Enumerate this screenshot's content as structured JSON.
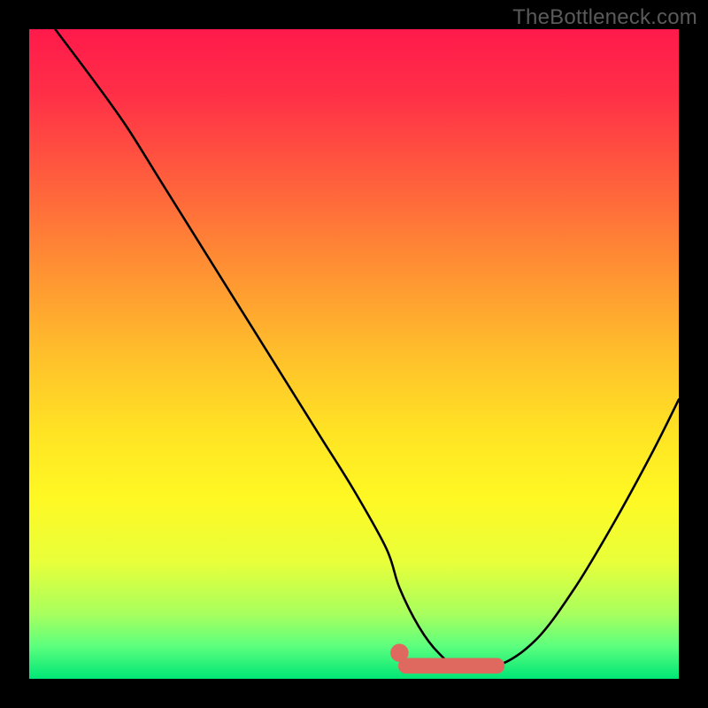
{
  "watermark": "TheBottleneck.com",
  "colors": {
    "frame": "#000000",
    "gradient_stops": [
      {
        "offset": 0.0,
        "color": "#ff1a4b"
      },
      {
        "offset": 0.1,
        "color": "#ff2f47"
      },
      {
        "offset": 0.22,
        "color": "#ff5a3e"
      },
      {
        "offset": 0.35,
        "color": "#ff8a34"
      },
      {
        "offset": 0.5,
        "color": "#ffbf2b"
      },
      {
        "offset": 0.62,
        "color": "#ffe324"
      },
      {
        "offset": 0.72,
        "color": "#fff823"
      },
      {
        "offset": 0.82,
        "color": "#e8ff3a"
      },
      {
        "offset": 0.9,
        "color": "#a8ff5e"
      },
      {
        "offset": 0.95,
        "color": "#5cff7e"
      },
      {
        "offset": 1.0,
        "color": "#00e676"
      }
    ],
    "marker": "#e0695f",
    "curve": "#000000"
  },
  "chart_data": {
    "type": "line",
    "title": "",
    "xlabel": "",
    "ylabel": "",
    "xlim": [
      0,
      100
    ],
    "ylim": [
      0,
      100
    ],
    "grid": false,
    "series": [
      {
        "name": "bottleneck-curve",
        "x": [
          4,
          10,
          15,
          20,
          25,
          30,
          35,
          40,
          45,
          50,
          55,
          57,
          60,
          63,
          66,
          72,
          78,
          84,
          90,
          96,
          100
        ],
        "values": [
          100,
          92,
          85,
          77,
          69,
          61,
          53,
          45,
          37,
          29,
          20,
          14,
          8,
          4,
          2,
          2,
          6,
          14,
          24,
          35,
          43
        ]
      }
    ],
    "markers": [
      {
        "name": "marker-dot",
        "shape": "circle",
        "x": 57,
        "y": 4,
        "r": 1.4
      },
      {
        "name": "marker-line",
        "shape": "segment",
        "x1": 58,
        "y1": 2,
        "x2": 72,
        "y2": 2,
        "width": 2.4,
        "cap": "round"
      }
    ]
  }
}
